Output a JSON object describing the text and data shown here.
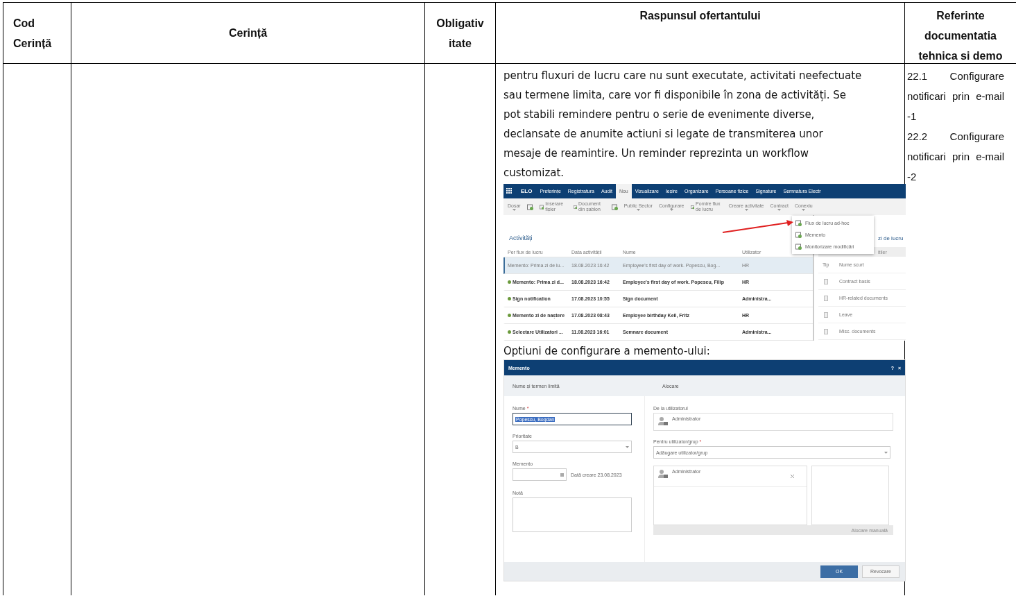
{
  "table": {
    "columns": [
      "Cod Cerință",
      "Cerință",
      "Obligativitate",
      "Raspunsul ofertantului",
      "Referinte documentatia tehnica si demo"
    ],
    "row": {
      "response": {
        "text": "pentru fluxuri de lucru care nu sunt executate, activitati neefectuate sau termene limita, care vor fi disponibile în zona de activități. Se pot stabili remindere pentru o serie de evenimente diverse, declansate de anumite actiuni si legate de transmiterea unor mesaje de reamintire. Un reminder reprezinta un workflow customizat.",
        "elo_window": {
          "logo": "ELO",
          "nav_tabs": [
            {
              "label": "Preferințe",
              "selected": false
            },
            {
              "label": "Registratura",
              "selected": false
            },
            {
              "label": "Audit",
              "selected": false
            },
            {
              "label": "Nou",
              "selected": true
            },
            {
              "label": "Vizualizare",
              "selected": false
            },
            {
              "label": "Ieșire",
              "selected": false
            },
            {
              "label": "Organizare",
              "selected": false
            },
            {
              "label": "Persoane fizice",
              "selected": false
            },
            {
              "label": "Signature",
              "selected": false
            },
            {
              "label": "Semnatura Electr",
              "selected": false
            }
          ],
          "toolbar": [
            {
              "kind": "dropdown",
              "label": "Dosar"
            },
            {
              "kind": "icon"
            },
            {
              "kind": "button",
              "label": "Inserare fișier"
            },
            {
              "kind": "button",
              "label": "Document din șablon"
            },
            {
              "kind": "icon"
            },
            {
              "kind": "dropdown",
              "label": "Public Sector"
            },
            {
              "kind": "dropdown",
              "label": "Configurare"
            },
            {
              "kind": "button",
              "label": "Pornire flux de lucru"
            },
            {
              "kind": "dropdown",
              "label": "Creare activitate"
            },
            {
              "kind": "dropdown",
              "label": "Contract"
            },
            {
              "kind": "dropdown",
              "label": "Conexiu"
            }
          ],
          "menu": [
            "Flux de lucru ad-hoc",
            "Memento",
            "Monitorizare modificări"
          ],
          "title": "Activități",
          "side_title": "zi de lucru",
          "side_header": "itiler",
          "columns": [
            "Per flux de lucru",
            "Data activității",
            "Nume",
            "Utilizator"
          ],
          "rows": [
            {
              "flow": "Memento: Prima zi de lu...",
              "date": "18.08.2023 16:42",
              "name": "Employee's first day of work. Popescu, Bog...",
              "user": "HR",
              "selected": true,
              "unread": false
            },
            {
              "flow": "Memento: Prima zi d...",
              "date": "18.08.2023 16:42",
              "name": "Employee's first day of work. Popescu, Filip",
              "user": "HR",
              "selected": false,
              "unread": true
            },
            {
              "flow": "Sign notification",
              "date": "17.08.2023 10:55",
              "name": "Sign document",
              "user": "Administra...",
              "selected": false,
              "unread": true
            },
            {
              "flow": "Memento zi de naștere",
              "date": "17.08.2023 08:43",
              "name": "Employee birthday Keil, Fritz",
              "user": "HR",
              "selected": false,
              "unread": true
            },
            {
              "flow": "Selectare Utilizatori ...",
              "date": "11.08.2023 16:01",
              "name": "Semnare document",
              "user": "Administra...",
              "selected": false,
              "unread": true
            }
          ],
          "side_columns": [
            "Tip",
            "Nume scurt"
          ],
          "side_rows": [
            "Contract basis",
            "HR-related documents",
            "Leave",
            "Misc. documents"
          ]
        },
        "caption": "Optiuni de configurare a memento-ului:",
        "dialog": {
          "title": "Memento",
          "help": "?",
          "close": "×",
          "tabs": [
            "Nume și termen limită",
            "Alocare"
          ],
          "name": {
            "label": "Nume",
            "marker": "*",
            "value": "Popescu, Bogdan"
          },
          "priority": {
            "label": "Prioritate",
            "value": "B"
          },
          "memento": {
            "label": "Memento",
            "created": "Dată creare 23.08.2023"
          },
          "note": {
            "label": "Notă"
          },
          "from": {
            "label": "De la utilizatorul",
            "value": "Administrator"
          },
          "to": {
            "label": "Pentru utilizator/grup",
            "marker": "*",
            "placeholder": "Adăugare utilizator/grup"
          },
          "assigned": [
            "Administrator"
          ],
          "manual": {
            "label": "Alocare manuală",
            "disabled": true
          },
          "buttons": [
            {
              "label": "OK",
              "primary": true
            },
            {
              "label": "Revocare",
              "primary": false
            }
          ]
        }
      },
      "references": [
        "22.1 Configurare notificari prin e-mail -1",
        "22.2 Configurare notificari prin e-mail -2"
      ]
    }
  }
}
